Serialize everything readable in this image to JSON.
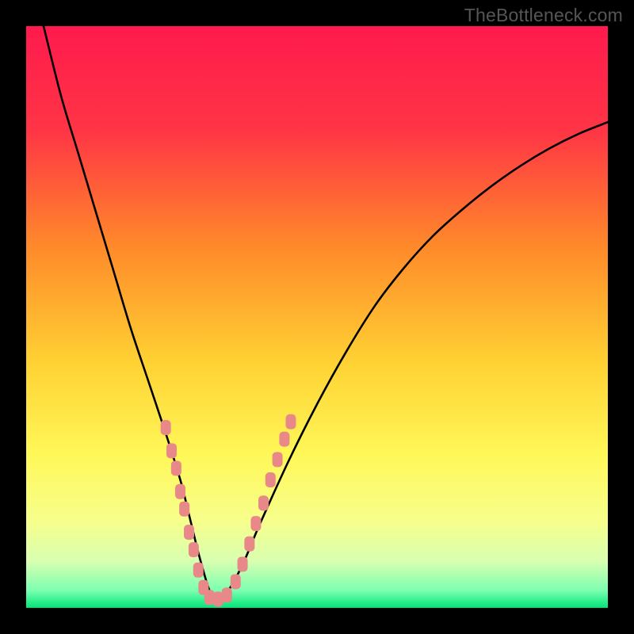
{
  "watermark": "TheBottleneck.com",
  "colors": {
    "frame": "#000000",
    "gradient_top": "#ff1a4d",
    "gradient_mid1": "#ff6a2d",
    "gradient_mid2": "#ffd233",
    "gradient_mid3": "#fff85a",
    "gradient_mid4": "#f2ff80",
    "gradient_bottom": "#00e676",
    "curve": "#000000",
    "marker": "#e98888",
    "marker_stroke": "#d96f6f"
  },
  "chart_data": {
    "type": "line",
    "title": "",
    "xlabel": "",
    "ylabel": "",
    "xlim": [
      0,
      100
    ],
    "ylim": [
      0,
      100
    ],
    "grid": false,
    "legend": false,
    "series": [
      {
        "name": "bottleneck-curve",
        "x": [
          3,
          6,
          9,
          12,
          15,
          18,
          21,
          24,
          26.5,
          28,
          30,
          32,
          34,
          37,
          40,
          45,
          50,
          55,
          60,
          65,
          70,
          75,
          80,
          85,
          90,
          95,
          100
        ],
        "y": [
          100,
          88,
          78,
          68,
          58,
          48,
          39,
          30,
          22,
          16,
          8,
          2,
          2,
          7,
          14,
          25,
          35,
          44,
          52,
          58.5,
          64,
          68.5,
          72.5,
          76,
          79,
          81.5,
          83.5
        ]
      }
    ],
    "markers": [
      {
        "x": 24.0,
        "y": 31
      },
      {
        "x": 25.0,
        "y": 27
      },
      {
        "x": 25.8,
        "y": 24
      },
      {
        "x": 26.5,
        "y": 20
      },
      {
        "x": 27.2,
        "y": 17
      },
      {
        "x": 28.0,
        "y": 13
      },
      {
        "x": 28.8,
        "y": 10
      },
      {
        "x": 29.6,
        "y": 6.5
      },
      {
        "x": 30.5,
        "y": 3.5
      },
      {
        "x": 31.5,
        "y": 1.8
      },
      {
        "x": 33.0,
        "y": 1.5
      },
      {
        "x": 34.5,
        "y": 2.2
      },
      {
        "x": 36.0,
        "y": 4.5
      },
      {
        "x": 37.2,
        "y": 7.5
      },
      {
        "x": 38.4,
        "y": 11
      },
      {
        "x": 39.5,
        "y": 14.5
      },
      {
        "x": 40.8,
        "y": 18
      },
      {
        "x": 42.0,
        "y": 22
      },
      {
        "x": 43.2,
        "y": 25.5
      },
      {
        "x": 44.4,
        "y": 29
      },
      {
        "x": 45.5,
        "y": 32
      }
    ],
    "annotations": []
  }
}
